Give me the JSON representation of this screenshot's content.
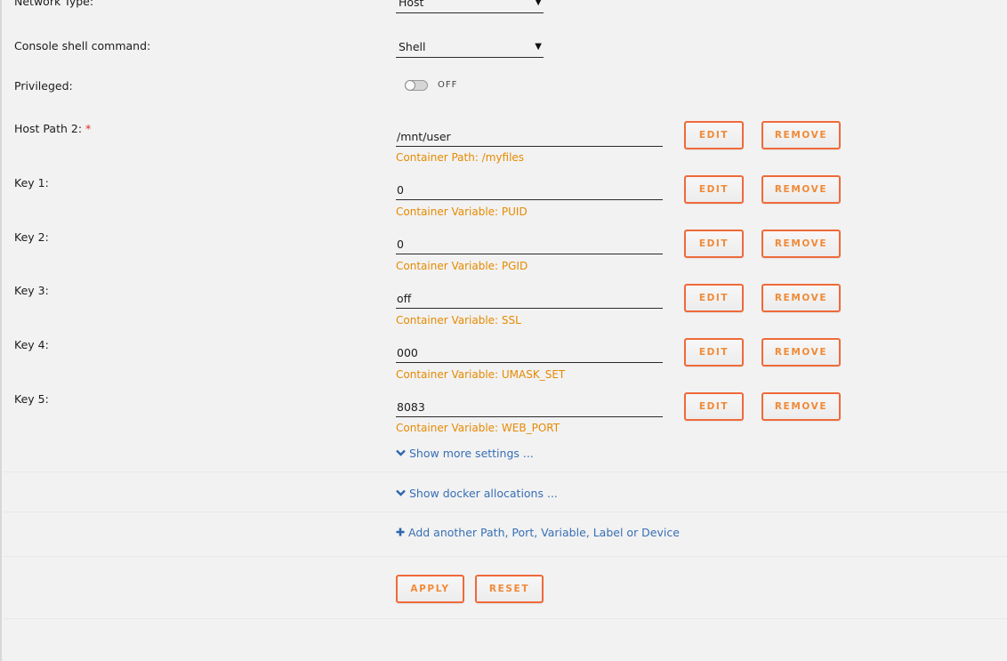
{
  "fields": {
    "network_type": {
      "label": "Network Type:",
      "value": "Host"
    },
    "console_shell": {
      "label": "Console shell command:",
      "value": "Shell"
    },
    "privileged": {
      "label": "Privileged:",
      "state": "OFF"
    }
  },
  "host_path": {
    "label": "Host Path 2:",
    "required_mark": "*",
    "value": "/mnt/user",
    "hint": "Container Path: /myfiles"
  },
  "keys": [
    {
      "label": "Key 1:",
      "value": "0",
      "hint": "Container Variable: PUID"
    },
    {
      "label": "Key 2:",
      "value": "0",
      "hint": "Container Variable: PGID"
    },
    {
      "label": "Key 3:",
      "value": "off",
      "hint": "Container Variable: SSL"
    },
    {
      "label": "Key 4:",
      "value": "000",
      "hint": "Container Variable: UMASK_SET"
    },
    {
      "label": "Key 5:",
      "value": "8083",
      "hint": "Container Variable: WEB_PORT"
    }
  ],
  "row_buttons": {
    "edit": "EDIT",
    "remove": "REMOVE"
  },
  "links": {
    "show_more": "Show more settings ...",
    "show_docker": "Show docker allocations ...",
    "add_another": "Add another Path, Port, Variable, Label or Device"
  },
  "footer_buttons": {
    "apply": "APPLY",
    "reset": "RESET"
  },
  "icons": {
    "chevron": "chevron-down-icon",
    "plus": "plus-icon",
    "caret": "caret-down-icon"
  },
  "colors": {
    "accent_orange": "#f08a38",
    "button_border": "#ef6a3a",
    "hint": "#e68a00",
    "link": "#386fb5",
    "required": "#e22828"
  }
}
